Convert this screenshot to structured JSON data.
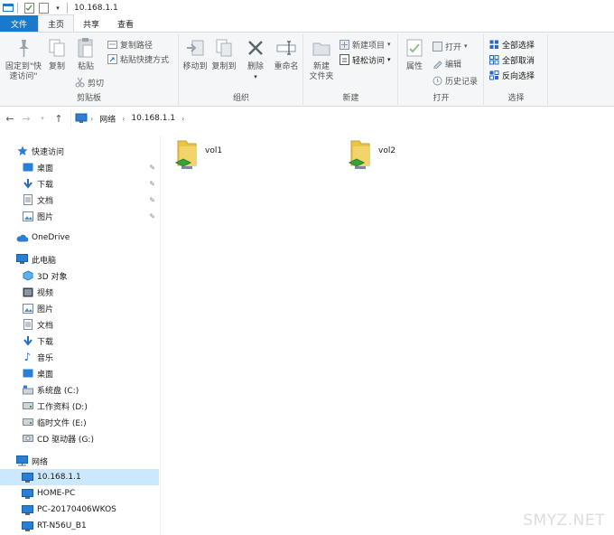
{
  "titlebar": {
    "title": "10.168.1.1"
  },
  "tabs": {
    "file": "文件",
    "home": "主页",
    "share": "共享",
    "view": "查看"
  },
  "ribbon": {
    "clipboard": {
      "pin_quick": "固定到\"快\n速访问\"",
      "copy": "复制",
      "paste": "粘贴",
      "copy_path": "复制路径",
      "paste_shortcut": "粘贴快捷方式",
      "cut": "剪切",
      "label": "剪贴板"
    },
    "organize": {
      "move_to": "移动到",
      "copy_to": "复制到",
      "delete": "删除",
      "rename": "重命名",
      "label": "组织"
    },
    "new": {
      "new_folder": "新建\n文件夹",
      "new_item": "新建项目",
      "easy_access": "轻松访问",
      "label": "新建"
    },
    "open": {
      "properties": "属性",
      "open": "打开",
      "edit": "编辑",
      "history": "历史记录",
      "label": "打开"
    },
    "select": {
      "select_all": "全部选择",
      "select_none": "全部取消",
      "invert": "反向选择",
      "label": "选择"
    }
  },
  "address": {
    "network": "网络",
    "host": "10.168.1.1"
  },
  "sidebar": {
    "quick_access": "快速访问",
    "qa_items": [
      "桌面",
      "下载",
      "文档",
      "图片"
    ],
    "onedrive": "OneDrive",
    "this_pc": "此电脑",
    "pc_items": [
      "3D 对象",
      "视频",
      "图片",
      "文档",
      "下载",
      "音乐",
      "桌面",
      "系统盘 (C:)",
      "工作资料 (D:)",
      "临时文件 (E:)",
      "CD 驱动器 (G:)"
    ],
    "network": "网络",
    "net_items": [
      "10.168.1.1",
      "HOME-PC",
      "PC-20170406WKOS",
      "RT-N56U_B1"
    ]
  },
  "content": {
    "items": [
      "vol1",
      "vol2"
    ]
  },
  "watermark": "SMYZ.NET",
  "colors": {
    "accent": "#1979ca",
    "selection": "#cce8ff",
    "folder": "#e8c44a"
  }
}
